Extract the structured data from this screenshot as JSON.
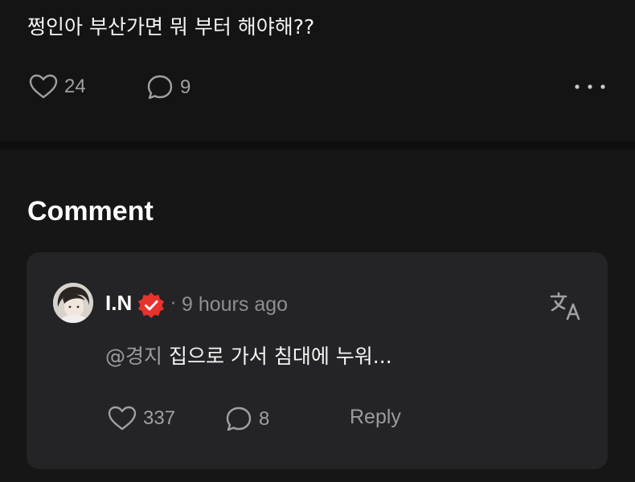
{
  "post": {
    "text": "쩡인아 부산가면 뭐 부터 해야해??",
    "likes": "24",
    "comments": "9"
  },
  "comments_section": {
    "title": "Comment"
  },
  "comment": {
    "author": "I.N",
    "separator": "·",
    "time": "9 hours ago",
    "mention": "@경지",
    "text": "집으로 가서 침대에 누워...",
    "likes": "337",
    "replies": "8",
    "reply_label": "Reply"
  },
  "colors": {
    "background": "#161617",
    "card": "#242427",
    "muted_text": "#9a9aa0",
    "verified_badge": "#e8322d"
  },
  "icons": [
    "heart-icon",
    "comment-bubble-icon",
    "more-icon",
    "verified-badge-icon",
    "translate-icon"
  ]
}
